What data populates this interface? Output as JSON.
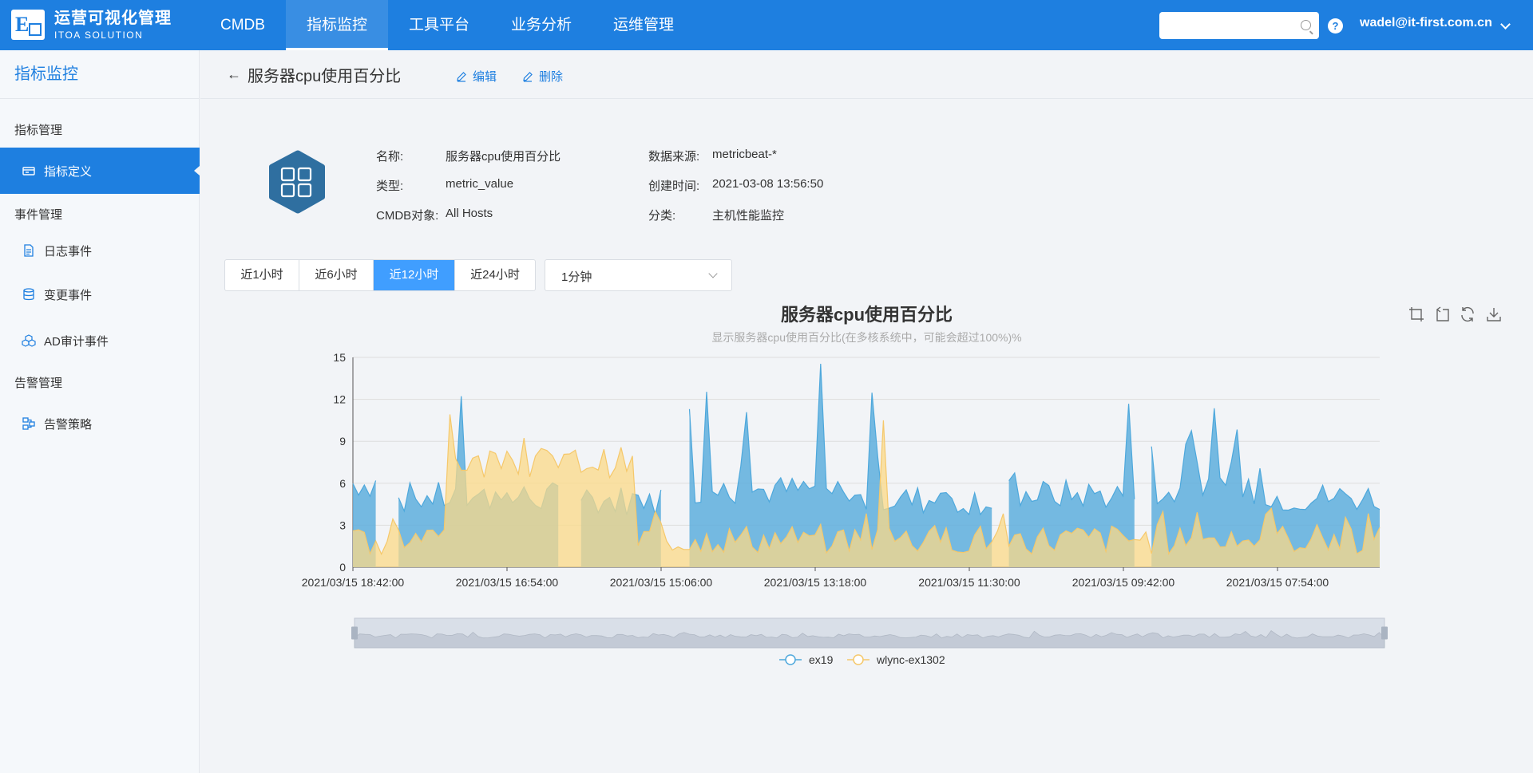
{
  "brand": {
    "title": "运营可视化管理",
    "subtitle": "ITOA SOLUTION",
    "color": "#1e7fe0"
  },
  "nav": {
    "items": [
      "CMDB",
      "指标监控",
      "工具平台",
      "业务分析",
      "运维管理"
    ],
    "active": "指标监控"
  },
  "search": {
    "placeholder": "",
    "icon": "search-icon"
  },
  "user": {
    "email": "wadel@it-first.com.cn",
    "help_icon": "?"
  },
  "sidebar": {
    "title": "指标监控",
    "groups": [
      "指标管理",
      "事件管理",
      "告警管理"
    ],
    "items": [
      {
        "label": "指标定义",
        "icon": "card-icon"
      },
      {
        "label": "日志事件",
        "icon": "document-icon"
      },
      {
        "label": "变更事件",
        "icon": "database-icon"
      },
      {
        "label": "AD审计事件",
        "icon": "cubes-icon"
      },
      {
        "label": "告警策略",
        "icon": "network-icon"
      }
    ],
    "active": "指标定义"
  },
  "header": {
    "title": "服务器cpu使用百分比",
    "edit": "编辑",
    "delete": "删除"
  },
  "info": {
    "name_label": "名称:",
    "name": "服务器cpu使用百分比",
    "type_label": "类型:",
    "type": "metric_value",
    "cmdb_label": "CMDB对象:",
    "cmdb": "All Hosts",
    "source_label": "数据来源:",
    "source": "metricbeat-*",
    "created_label": "创建时间:",
    "created": "2021-03-08 13:56:50",
    "category_label": "分类:",
    "category": "主机性能监控"
  },
  "ranges": [
    "近1小时",
    "近6小时",
    "近12小时",
    "近24小时"
  ],
  "active_range": "近12小时",
  "interval": "1分钟",
  "chart_data": {
    "type": "area",
    "title": "服务器cpu使用百分比",
    "subtitle": "显示服务器cpu使用百分比(在多核系统中，可能会超过100%)%",
    "ylim": [
      0,
      15
    ],
    "yticks": [
      0,
      3,
      6,
      9,
      12,
      15
    ],
    "x_tick_labels": [
      "2021/03/15 18:42:00",
      "2021/03/15 16:54:00",
      "2021/03/15 15:06:00",
      "2021/03/15 13:18:00",
      "2021/03/15 11:30:00",
      "2021/03/15 09:42:00",
      "2021/03/15 07:54:00"
    ],
    "x_order": "descending time, left to right",
    "grid": true,
    "legend_position": "bottom",
    "series": [
      {
        "name": "ex19",
        "color": "#4ea8dc",
        "fill": "#5eaedd",
        "segments": [
          {
            "x_range": [
              0,
              5
            ],
            "base": 6.0,
            "spike_max": 11.5
          },
          {
            "x_range": [
              5,
              42
            ],
            "base": 5.0,
            "spike_max": 12.8
          },
          {
            "x_range": [
              42,
              55
            ],
            "base": 4.8,
            "spike_max": 10.0
          },
          {
            "x_range": [
              55,
              87
            ],
            "base": 5.5,
            "spike_max": 14.8
          },
          {
            "x_range": [
              87,
              113
            ],
            "base": 4.8,
            "spike_max": 12.8
          },
          {
            "x_range": [
              113,
              138
            ],
            "base": 5.2,
            "spike_max": 12.5
          },
          {
            "x_range": [
              138,
              162
            ],
            "base": 5.3,
            "spike_max": 12.5
          },
          {
            "x_range": [
              162,
              180
            ],
            "base": 5.0,
            "spike_max": 12.3
          }
        ],
        "gaps": [
          [
            4.5,
            7
          ],
          [
            37,
            39
          ],
          [
            55,
            58
          ],
          [
            112.5,
            114
          ],
          [
            137.5,
            139
          ]
        ]
      },
      {
        "name": "wlync-ex1302",
        "color": "#f5c86b",
        "fill": "#fbd987",
        "segments": [
          {
            "x_range": [
              0,
              17
            ],
            "base": 2.0,
            "spike_max": 3.5
          },
          {
            "x_range": [
              17,
              50
            ],
            "base": 7.5,
            "spike_max": 11.0
          },
          {
            "x_range": [
              50,
              180
            ],
            "base": 2.0,
            "spike_max": 4.5
          }
        ],
        "tall_spike": {
          "x": 93,
          "value": 10.5
        }
      }
    ]
  }
}
